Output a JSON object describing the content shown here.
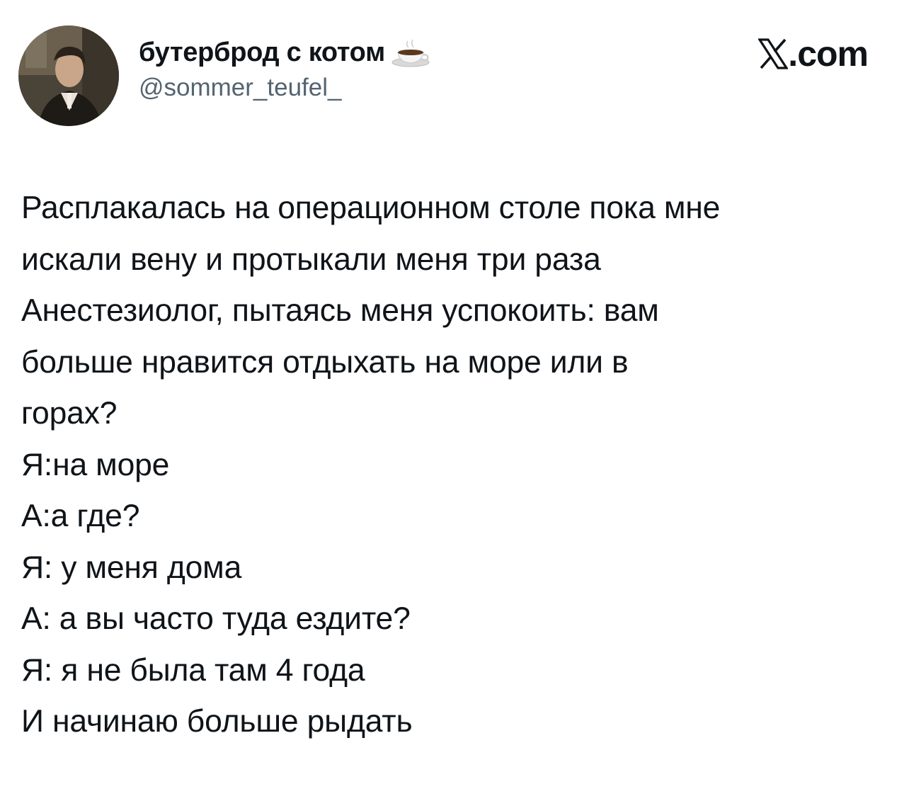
{
  "author": {
    "display_name": "бутерброд с котом",
    "handle": "@sommer_teufel_",
    "name_emoji": "coffee-cup-icon",
    "avatar": "profile-photo"
  },
  "brand": {
    "icon": "x-logo-icon",
    "text": ".com"
  },
  "tweet": {
    "lines": [
      "Расплакалась на операционном столе пока мне",
      "искали вену и протыкали меня три раза",
      "Анестезиолог, пытаясь меня успокоить: вам",
      "больше нравится отдыхать на море или в",
      "горах?",
      "Я:на море",
      "А:а где?",
      "Я: у меня дома",
      "А: а вы часто туда ездите?",
      "Я: я не была там 4 года",
      "И начинаю больше рыдать"
    ]
  },
  "colors": {
    "text_primary": "#0f1419",
    "text_secondary": "#536471",
    "background": "#ffffff"
  }
}
